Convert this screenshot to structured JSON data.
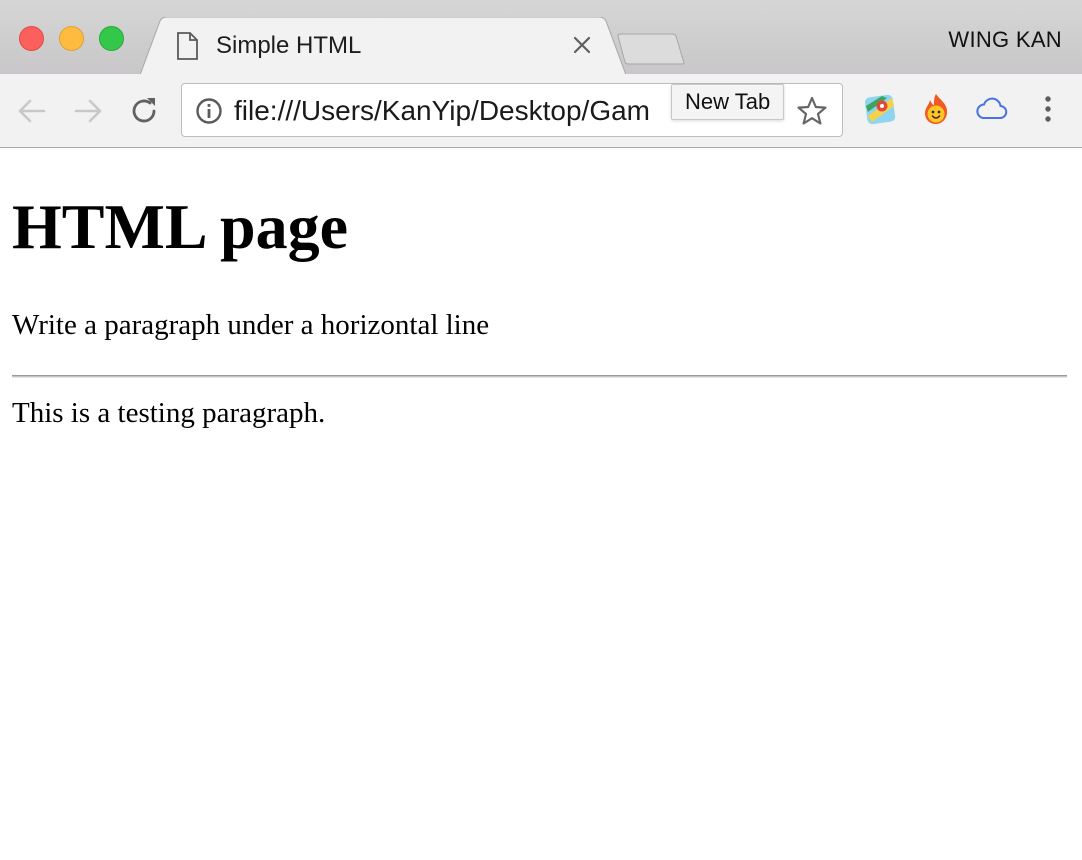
{
  "window": {
    "profile_name": "WING KAN",
    "traffic_lights": {
      "close": "#fc605c",
      "minimize": "#fdbc40",
      "zoom": "#34c84a"
    }
  },
  "tabs": [
    {
      "title": "Simple HTML",
      "active": true,
      "icon": "document-icon"
    }
  ],
  "new_tab_tooltip": "New Tab",
  "toolbar": {
    "url": "file:///Users/KanYip/Desktop/Gam",
    "extensions": [
      "maps-pin-icon",
      "fire-face-icon",
      "cloud-icon"
    ]
  },
  "page": {
    "heading": "HTML page",
    "intro": "Write a paragraph under a horizontal line",
    "paragraph": "This is a testing paragraph."
  }
}
